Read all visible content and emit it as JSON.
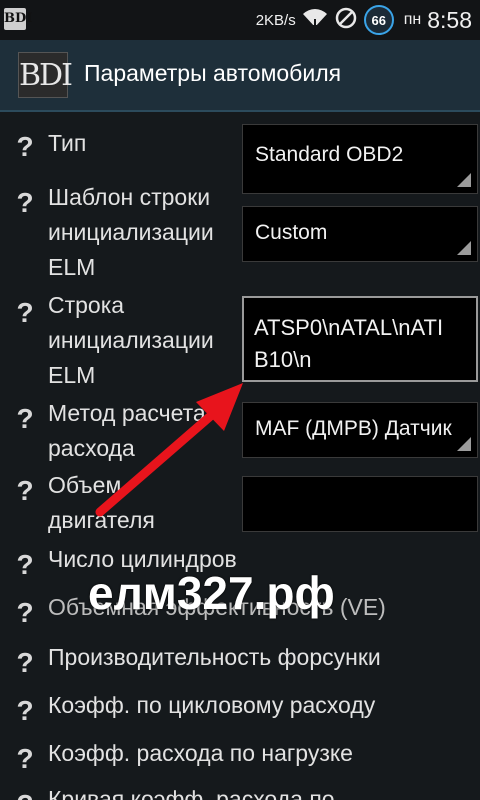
{
  "status_bar": {
    "app_icon": "BDI",
    "speed": "2KB/s",
    "battery": "66",
    "day": "пн",
    "time": "8:58",
    "icons": [
      "wifi-icon",
      "no-signal-icon",
      "battery-icon"
    ]
  },
  "action_bar": {
    "logo": "BDI",
    "title": "Параметры автомобиля"
  },
  "settings": [
    {
      "label": "Тип",
      "value": "Standard OBD2"
    },
    {
      "label_lines": [
        "Шаблон строки",
        "инициализации",
        "ELM"
      ],
      "value": "Custom"
    },
    {
      "label_lines": [
        "Строка",
        "инициализации",
        "ELM"
      ],
      "value_lines": [
        "ATSP0\\nATAL\\nATI",
        "B10\\n"
      ]
    },
    {
      "label_lines": [
        "Метод расчета",
        "расхода"
      ],
      "value": "MAF (ДМРВ) Датчик"
    },
    {
      "label_lines": [
        "Объем",
        "двигателя"
      ],
      "value": ""
    },
    {
      "label": "Число цилиндров"
    },
    {
      "label": "Объемная эффективность (VE)"
    },
    {
      "label": "Производительность форсунки"
    },
    {
      "label": "Коэфф. по цикловому расходу"
    },
    {
      "label": "Коэфф. расхода по нагрузке"
    },
    {
      "label": "Кривая коэфф. расхода по"
    }
  ],
  "watermark": "елм327.рф",
  "colors": {
    "background": "#15191c",
    "action_bar": "#1e2f3a",
    "arrow": "#e8141c",
    "battery_ring": "#3aa4e8"
  }
}
